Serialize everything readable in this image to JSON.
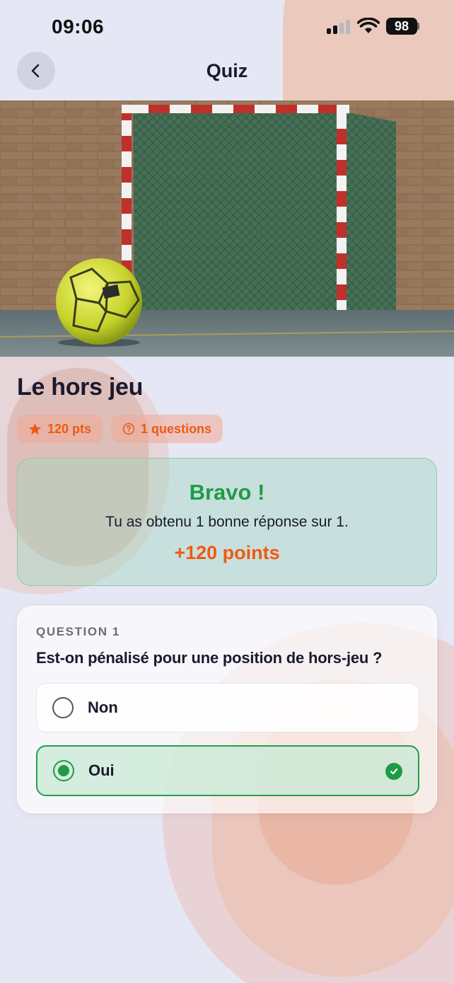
{
  "status_bar": {
    "time": "09:06",
    "battery": "98",
    "icons": [
      "cellular-signal-icon",
      "wifi-icon",
      "battery-icon"
    ]
  },
  "nav": {
    "title": "Quiz",
    "back_icon": "chevron-left-icon"
  },
  "hero_image": {
    "subject": "handball ball in front of a goal with net on an indoor court"
  },
  "quiz": {
    "title": "Le hors jeu",
    "badges": {
      "points": "120 pts",
      "points_icon": "star-icon",
      "questions": "1 questions",
      "questions_icon": "help-circle-icon"
    }
  },
  "result": {
    "title": "Bravo !",
    "text": "Tu as obtenu 1 bonne réponse sur 1.",
    "points": "+120 points"
  },
  "question": {
    "label": "QUESTION 1",
    "text": "Est-on pénalisé pour une position de hors-jeu ?",
    "options": [
      {
        "label": "Non",
        "selected": false,
        "correct": false
      },
      {
        "label": "Oui",
        "selected": true,
        "correct": true
      }
    ]
  },
  "colors": {
    "accent_orange": "#ea5b14",
    "success_green": "#1f9b46",
    "background": "#e6e7f4"
  }
}
